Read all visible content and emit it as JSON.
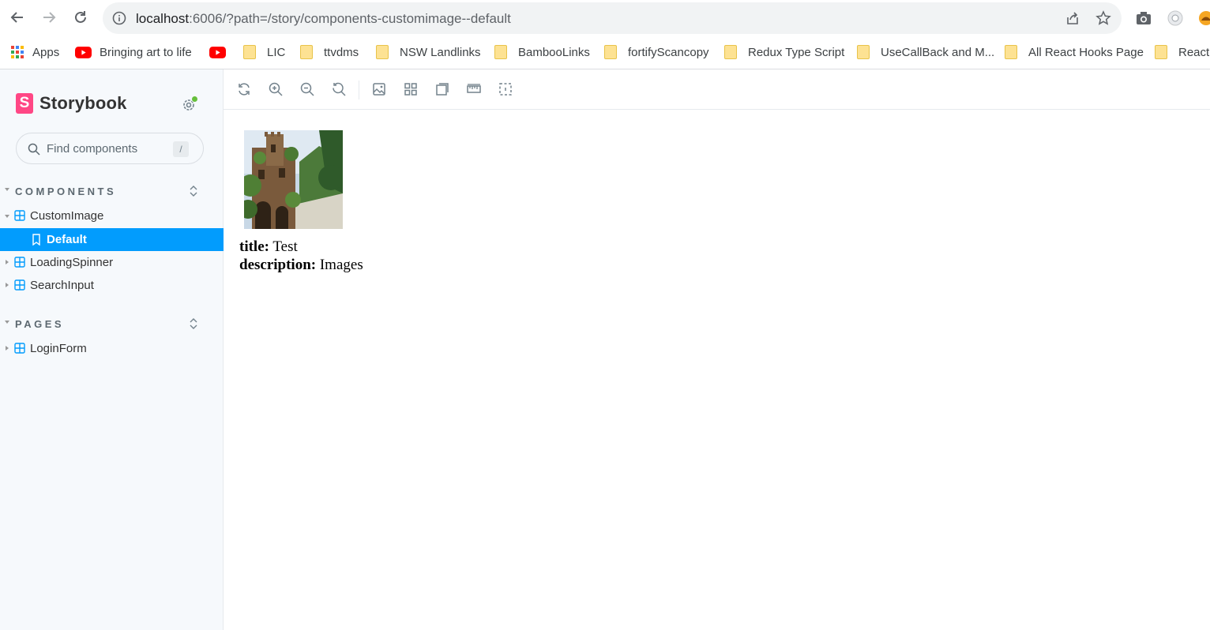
{
  "browser": {
    "url_host": "localhost",
    "url_rest": ":6006/?path=/story/components-customimage--default",
    "bookmarks": [
      {
        "label": "Apps",
        "icon": "apps-grid-icon"
      },
      {
        "label": "Bringing art to life",
        "icon": "youtube-icon"
      },
      {
        "label": "",
        "icon": "youtube-icon"
      },
      {
        "label": "LIC",
        "icon": "folder-icon"
      },
      {
        "label": "ttvdms",
        "icon": "folder-icon"
      },
      {
        "label": "NSW Landlinks",
        "icon": "folder-icon"
      },
      {
        "label": "BambooLinks",
        "icon": "folder-icon"
      },
      {
        "label": "fortifyScancopy",
        "icon": "folder-icon"
      },
      {
        "label": "Redux Type Script",
        "icon": "folder-icon"
      },
      {
        "label": "UseCallBack and M...",
        "icon": "folder-icon"
      },
      {
        "label": "All React Hooks Page",
        "icon": "folder-icon"
      },
      {
        "label": "React T",
        "icon": "folder-icon"
      }
    ]
  },
  "sidebar": {
    "brand": "Storybook",
    "brand_logo": "S",
    "search_placeholder": "Find components",
    "search_shortcut": "/",
    "sections": [
      {
        "label": "COMPONENTS",
        "items": [
          {
            "label": "CustomImage",
            "expanded": true
          },
          {
            "label": "Default",
            "selected": true
          },
          {
            "label": "LoadingSpinner"
          },
          {
            "label": "SearchInput"
          }
        ]
      },
      {
        "label": "PAGES",
        "items": [
          {
            "label": "LoginForm"
          }
        ]
      }
    ]
  },
  "story": {
    "title_label": "title:",
    "title_value": "Test",
    "description_label": "description:",
    "description_value": "Images"
  },
  "colors": {
    "accent": "#029cfd",
    "brand": "#ff4785",
    "status_dot": "#66bf3c"
  }
}
